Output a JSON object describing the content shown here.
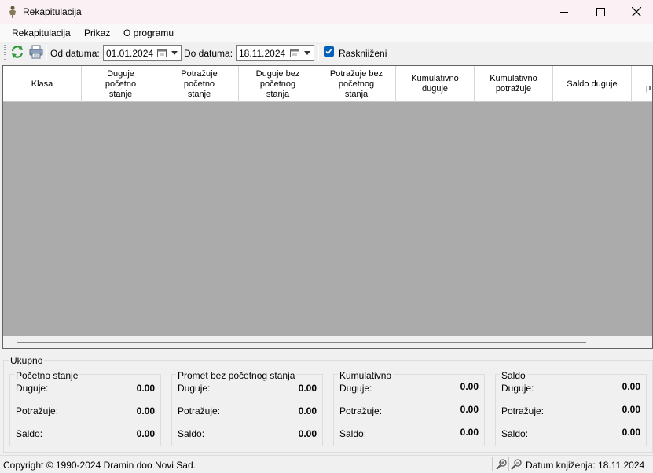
{
  "window": {
    "title": "Rekapitulacija",
    "icon": "app-figure-icon"
  },
  "menu": {
    "items": [
      "Rekapitulacija",
      "Prikaz",
      "O programu"
    ]
  },
  "toolbar": {
    "refresh_icon": "refresh-icon",
    "print_icon": "printer-icon",
    "from_label": "Od datuma:",
    "from_value": "01.01.2024",
    "to_label": "Do datuma:",
    "to_value": "18.11.2024",
    "unposted_label": "Raskniiženi",
    "unposted_checked": true
  },
  "grid": {
    "columns": [
      "Klasa",
      "Duguje\npočetno\nstanje",
      "Potražuje\npočetno\nstanje",
      "Duguje bez\npočetnog\nstanja",
      "Potražuje bez\npočetnog\nstanja",
      "Kumulativno\nduguje",
      "Kumulativno\npotražuje",
      "Saldo duguje",
      "p"
    ],
    "rows": []
  },
  "totals": {
    "title": "Ukupno",
    "groups": [
      {
        "title": "Početno stanje",
        "rows": [
          {
            "label": "Duguje:",
            "value": "0.00"
          },
          {
            "label": "Potražuje:",
            "value": "0.00"
          },
          {
            "label": "Saldo:",
            "value": "0.00"
          }
        ]
      },
      {
        "title": "Promet bez početnog stanja",
        "rows": [
          {
            "label": "Duguje:",
            "value": "0.00"
          },
          {
            "label": "Potražuje:",
            "value": "0.00"
          },
          {
            "label": "Saldo:",
            "value": "0.00"
          }
        ]
      },
      {
        "title": "Kumulativno",
        "rows": [
          {
            "label": "Duguje:",
            "value": "0.00"
          },
          {
            "label": "Potražuje:",
            "value": "0.00"
          },
          {
            "label": "Saldo:",
            "value": "0.00"
          }
        ]
      },
      {
        "title": "Saldo",
        "rows": [
          {
            "label": "Duguje:",
            "value": "0.00"
          },
          {
            "label": "Potražuje:",
            "value": "0.00"
          },
          {
            "label": "Saldo:",
            "value": "0.00"
          }
        ]
      }
    ]
  },
  "status": {
    "copyright": "Copyright © 1990-2024 Dramin doo Novi Sad.",
    "booking_date": "Datum knjiženja: 18.11.2024",
    "icons": [
      "zoom-in-icon",
      "zoom-out-icon"
    ]
  },
  "colors": {
    "titlebar_bg": "#fbf1f4",
    "grid_bg": "#ababab",
    "checkbox_accent": "#005fb8",
    "refresh_green": "#2e9a3a"
  }
}
